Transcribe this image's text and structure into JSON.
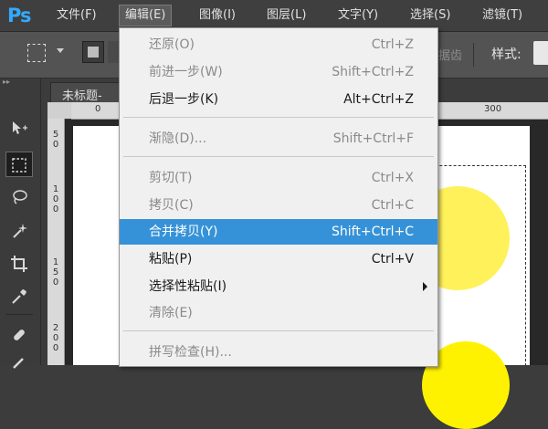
{
  "app": {
    "logo": "Ps"
  },
  "menubar": {
    "items": [
      {
        "label": "文件(F)"
      },
      {
        "label": "编辑(E)"
      },
      {
        "label": "图像(I)"
      },
      {
        "label": "图层(L)"
      },
      {
        "label": "文字(Y)"
      },
      {
        "label": "选择(S)"
      },
      {
        "label": "滤镜(T)"
      }
    ],
    "active_index": 1
  },
  "options_bar": {
    "edges_partial": "据齿",
    "style_label": "样式:"
  },
  "document": {
    "tab_label": "未标题-",
    "ruler_h": [
      "0",
      "300"
    ],
    "ruler_v": [
      "50",
      "100",
      "150",
      "200"
    ]
  },
  "edit_menu": {
    "items": [
      {
        "label": "还原(O)",
        "shortcut": "Ctrl+Z",
        "state": "disabled"
      },
      {
        "label": "前进一步(W)",
        "shortcut": "Shift+Ctrl+Z",
        "state": "disabled"
      },
      {
        "label": "后退一步(K)",
        "shortcut": "Alt+Ctrl+Z",
        "state": "enabled"
      },
      {
        "label": "渐隐(D)...",
        "shortcut": "Shift+Ctrl+F",
        "state": "disabled"
      },
      {
        "label": "剪切(T)",
        "shortcut": "Ctrl+X",
        "state": "disabled"
      },
      {
        "label": "拷贝(C)",
        "shortcut": "Ctrl+C",
        "state": "disabled"
      },
      {
        "label": "合并拷贝(Y)",
        "shortcut": "Shift+Ctrl+C",
        "state": "highlighted"
      },
      {
        "label": "粘贴(P)",
        "shortcut": "Ctrl+V",
        "state": "enabled"
      },
      {
        "label": "选择性粘贴(I)",
        "shortcut": "",
        "state": "enabled",
        "submenu": true
      },
      {
        "label": "清除(E)",
        "shortcut": "",
        "state": "disabled"
      },
      {
        "label": "拼写检查(H)...",
        "shortcut": "",
        "state": "disabled"
      }
    ]
  },
  "colors": {
    "highlight": "#3592d8",
    "yellow_circle": "#fff15a",
    "ps_blue": "#34a9ff"
  }
}
